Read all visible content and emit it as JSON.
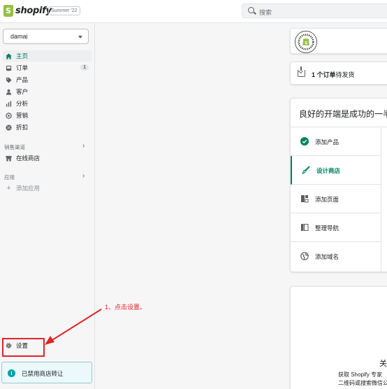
{
  "topbar": {
    "logo_text": "shopify",
    "edition": "Summer '22",
    "search_placeholder": "搜索"
  },
  "sidebar": {
    "store_name": "damai",
    "nav": [
      {
        "label": "主页",
        "icon": "home-icon",
        "active": true
      },
      {
        "label": "订单",
        "icon": "orders-icon",
        "badge": "1"
      },
      {
        "label": "产品",
        "icon": "tag-icon"
      },
      {
        "label": "客户",
        "icon": "person-icon"
      },
      {
        "label": "分析",
        "icon": "analytics-icon"
      },
      {
        "label": "营销",
        "icon": "marketing-icon"
      },
      {
        "label": "折扣",
        "icon": "discount-icon"
      }
    ],
    "sales_channels": {
      "heading": "销售渠道",
      "items": [
        {
          "label": "在线商店",
          "icon": "store-icon"
        }
      ]
    },
    "apps": {
      "heading": "应用",
      "add_label": "添加应用"
    },
    "settings_label": "设置",
    "notice_text": "已禁用商店转让"
  },
  "annotation": {
    "text": "1、点击设置。",
    "color": "#e02424"
  },
  "main": {
    "orders": {
      "count_text": "1 个订单",
      "status_text": "待发货"
    },
    "setup": {
      "title": "良好的开端是成功的一半",
      "steps": [
        {
          "label": "添加产品",
          "icon": "check-circle-icon",
          "done": true
        },
        {
          "label": "设计商店",
          "icon": "brush-icon",
          "active": true
        },
        {
          "label": "添加页面",
          "icon": "page-icon"
        },
        {
          "label": "整理导航",
          "icon": "navigation-icon"
        },
        {
          "label": "添加域名",
          "icon": "globe-icon"
        }
      ]
    },
    "help": {
      "title": "关",
      "line1": "获取 Shopify 专家",
      "line2": "二维码或搜索微信公"
    }
  },
  "colors": {
    "accent": "#008060",
    "annotation_red": "#e02424",
    "brand_green": "#95bf47"
  }
}
